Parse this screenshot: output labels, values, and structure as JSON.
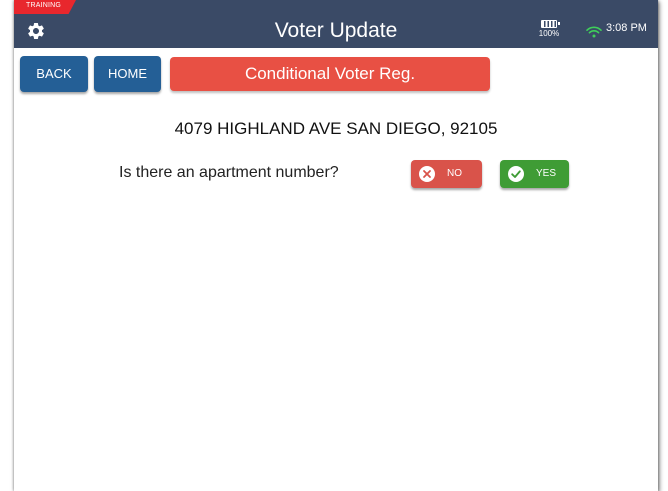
{
  "header": {
    "training_label": "TRAINING",
    "title": "Voter Update",
    "battery_percent": "100%",
    "time": "3:08 PM",
    "background_color": "#3a4a66",
    "icons": [
      "gear-icon",
      "battery-icon",
      "wifi-icon"
    ]
  },
  "nav": {
    "back_label": "BACK",
    "home_label": "HOME",
    "banner_label": "Conditional Voter Reg.",
    "nav_button_color": "#245f96",
    "banner_color": "#e85044"
  },
  "main": {
    "address": "4079 HIGHLAND AVE SAN DIEGO, 92105",
    "question": "Is there an apartment number?",
    "no_label": "NO",
    "yes_label": "YES",
    "no_color": "#d9534a",
    "yes_color": "#3f9c35",
    "icons": [
      "close-circle-icon",
      "check-circle-icon"
    ]
  }
}
